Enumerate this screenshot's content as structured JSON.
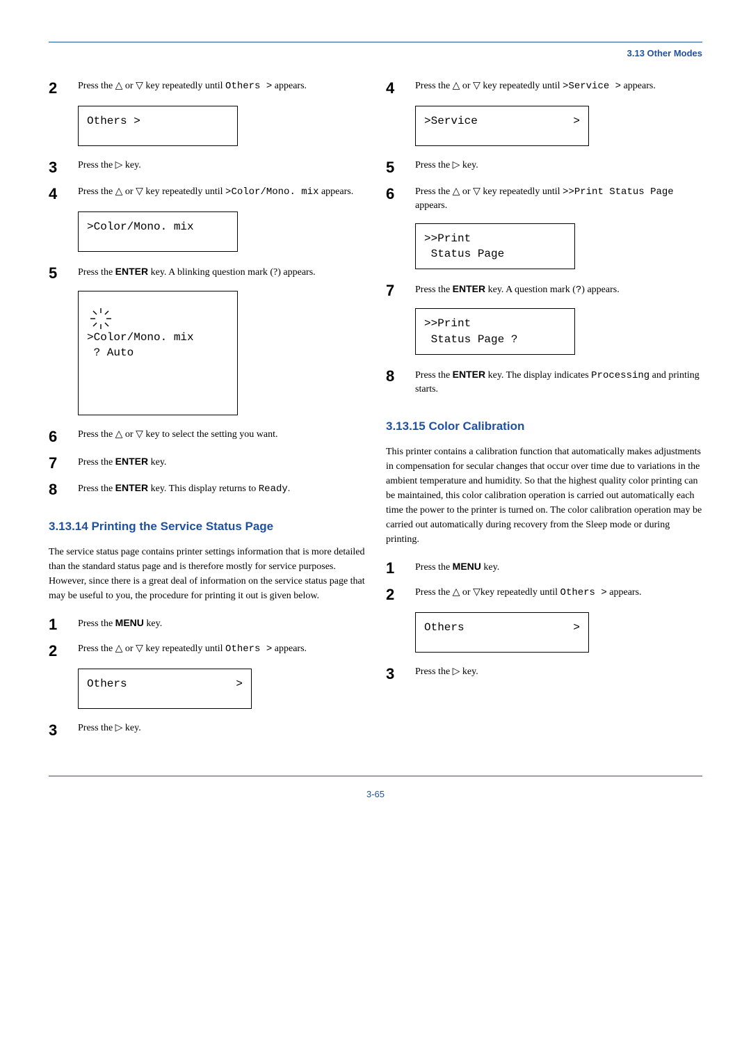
{
  "header": {
    "section": "3.13 Other Modes"
  },
  "left": {
    "s2": {
      "text_a": "Press the △ or ▽ key repeatedly until ",
      "code": "Others >",
      "text_b": " appears."
    },
    "lcd2": "Others >",
    "s3": {
      "text": "Press the ▷ key."
    },
    "s4": {
      "text_a": "Press the △ or ▽ key repeatedly until ",
      "code": ">Color/Mono. mix",
      "text_b": " appears."
    },
    "lcd4": ">Color/Mono. mix",
    "s5": {
      "text_a": "Press the ",
      "bold": "ENTER",
      "text_b": " key. A blinking question mark (?) appears."
    },
    "lcd5_l1": ">Color/Mono. mix",
    "lcd5_l2": " ? Auto",
    "s6": {
      "text": "Press the △ or ▽ key to select the setting you want."
    },
    "s7": {
      "text_a": "Press the ",
      "bold": "ENTER",
      "text_b": " key."
    },
    "s8": {
      "text_a": "Press the ",
      "bold": "ENTER",
      "text_b": " key. This display returns to ",
      "code": "Ready",
      "text_c": "."
    },
    "h2": "3.13.14  Printing the Service Status Page",
    "para": "The service status page contains printer settings information that is more detailed than the standard status page and is therefore mostly for service purposes. However, since there is a great deal of information on the service status page that may be useful to you, the procedure for printing it out is given below.",
    "b1": {
      "text_a": "Press the ",
      "bold": "MENU",
      "text_b": " key."
    },
    "b2": {
      "text_a": "Press the △ or ▽ key repeatedly until ",
      "code": "Others >",
      "text_b": " appears."
    },
    "lcd_b2_a": "Others",
    "lcd_b2_b": ">",
    "b3": {
      "text": "Press the ▷ key."
    }
  },
  "right": {
    "s4": {
      "text_a": "Press the △ or ▽ key repeatedly until ",
      "code": ">Service >",
      "text_b": " appears."
    },
    "lcd4_a": ">Service",
    "lcd4_b": ">",
    "s5": {
      "text": "Press the ▷ key."
    },
    "s6": {
      "text_a": "Press the △ or ▽ key repeatedly until ",
      "code": ">>Print Status Page",
      "text_b": " appears."
    },
    "lcd6_l1": ">>Print",
    "lcd6_l2": " Status Page",
    "s7": {
      "text_a": "Press the ",
      "bold": "ENTER",
      "text_b": " key. A question mark (",
      "code": "?",
      "text_c": ") appears."
    },
    "lcd7_l1": ">>Print",
    "lcd7_l2": " Status Page ?",
    "s8": {
      "text_a": "Press the ",
      "bold": "ENTER",
      "text_b": " key. The display indicates ",
      "code": "Processing",
      "text_c": " and printing starts."
    },
    "h2": "3.13.15  Color Calibration",
    "para": "This printer contains a calibration function that automatically makes adjustments in compensation for secular changes that occur over time due to variations in the ambient temperature and humidity. So that the highest quality color printing can be maintained, this color calibration operation is carried out automatically each time the power to the printer is turned on. The color calibration operation may be carried out automatically during recovery from the Sleep mode or during printing.",
    "c1": {
      "text_a": "Press the ",
      "bold": "MENU",
      "text_b": " key."
    },
    "c2": {
      "text_a": "Press the △ or ▽key repeatedly until ",
      "code": "Others >",
      "text_b": " appears."
    },
    "lcd_c2_a": "Others",
    "lcd_c2_b": ">",
    "c3": {
      "text": "Press the ▷ key."
    }
  },
  "footer": {
    "page": "3-65"
  }
}
